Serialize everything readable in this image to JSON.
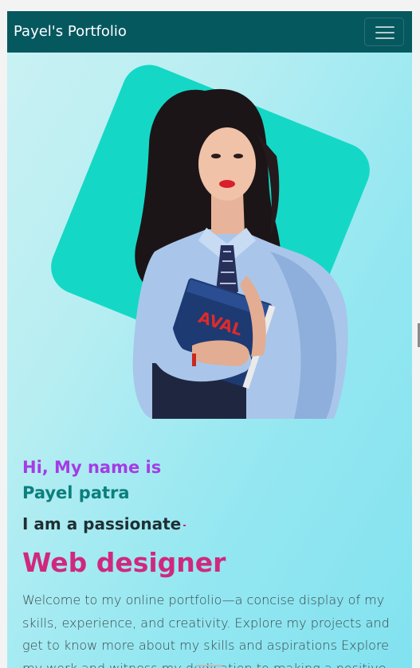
{
  "navbar": {
    "brand": "Payel's Portfolio",
    "menu_icon": "hamburger-menu-icon"
  },
  "hero": {
    "photo_alt": "Payel patra portrait",
    "greeting": "Hi, My name is",
    "name": "Payel patra",
    "tagline": "I am a passionate",
    "role": "Web designer",
    "intro": "Welcome to my online portfolio—a concise display of my skills, experience, and creativity. Explore my projects and get to know more about my skills and aspirations Explore my work and witness my dedication to making a positive"
  },
  "book_text": "AVAL",
  "colors": {
    "navbar": "#06585f",
    "accent_blob": "#14d8c5",
    "greeting": "#a53be6",
    "name": "#0b7f7d",
    "role": "#d0287e"
  }
}
